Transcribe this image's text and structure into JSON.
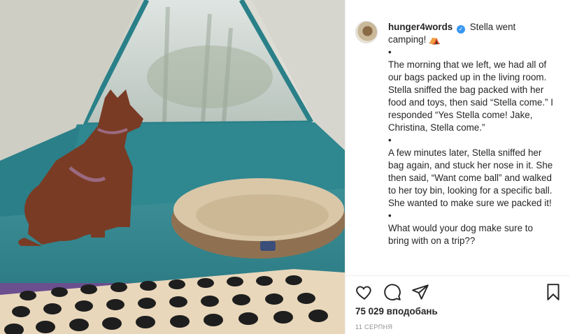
{
  "post": {
    "image_alt": "Dog sitting in a tent next to a dog bed and a button board",
    "username": "hunger4words",
    "caption_start": "Stella went camping! ⛺",
    "paragraphs": [
      "•",
      "The morning that we left, we had all of our bags packed up in the living room. Stella sniffed the bag packed with her food and toys, then said “Stella come.” I responded “Yes Stella come! Jake, Christina, Stella come.”",
      "•",
      "A few minutes later, Stella sniffed her bag again, and stuck her nose in it. She then said, “Want come ball” and walked to her toy bin, looking for a specific ball. She wanted to make sure we packed it!",
      "•",
      "What would your dog make sure to bring with on a trip??"
    ],
    "likes": "75 029 вподобань",
    "date": "11 СЕРПНЯ"
  },
  "icons": {
    "like": "heart-icon",
    "comment": "comment-icon",
    "share": "paper-plane-icon",
    "save": "bookmark-icon",
    "verified": "verified-badge-icon"
  },
  "colors": {
    "verified": "#3897f0",
    "text": "#262626",
    "muted": "#8e8e8e"
  }
}
